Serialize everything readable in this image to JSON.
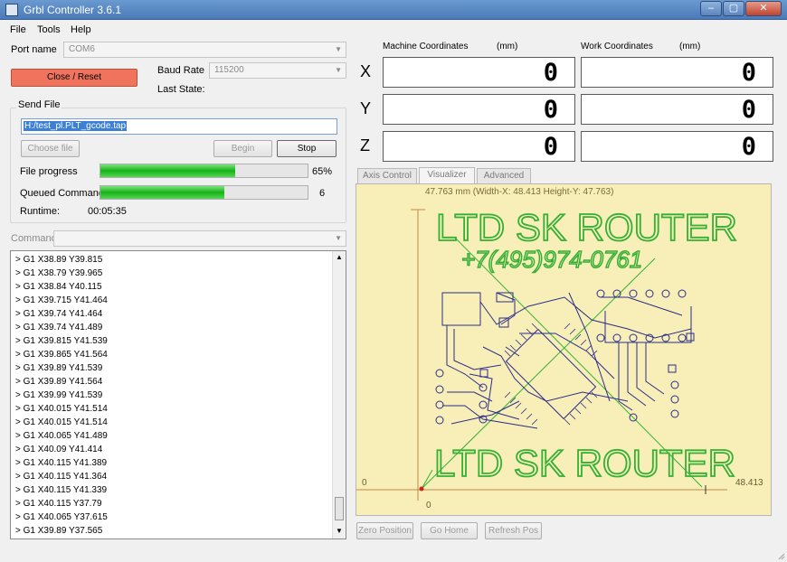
{
  "window": {
    "title": "Grbl Controller 3.6.1",
    "buttons": [
      "–",
      "▢",
      "✕"
    ]
  },
  "menu": [
    "File",
    "Tools",
    "Help"
  ],
  "port": {
    "label": "Port name",
    "value": "COM6"
  },
  "close_reset_label": "Close / Reset",
  "baud": {
    "label": "Baud Rate",
    "value": "115200"
  },
  "last_state_label": "Last State:",
  "send_file": {
    "group_label": "Send File",
    "path": "H:/test_pl.PLT_gcode.tap",
    "choose_label": "Choose file",
    "begin_label": "Begin",
    "stop_label": "Stop",
    "file_progress_label": "File progress",
    "file_progress_value": "65%",
    "file_progress_fraction": 0.65,
    "queued_label": "Queued Commands",
    "queued_value": "6",
    "queued_fraction": 0.6,
    "runtime_label": "Runtime:",
    "runtime_value": "00:05:35"
  },
  "command_label": "Command",
  "console_lines": [
    "> G1 X38.89 Y39.815",
    "> G1 X38.79 Y39.965",
    "> G1 X38.84 Y40.115",
    "> G1 X39.715 Y41.464",
    "> G1 X39.74 Y41.464",
    "> G1 X39.74 Y41.489",
    "> G1 X39.815 Y41.539",
    "> G1 X39.865 Y41.564",
    "> G1 X39.89 Y41.539",
    "> G1 X39.89 Y41.564",
    "> G1 X39.99 Y41.539",
    "> G1 X40.015 Y41.514",
    "> G1 X40.015 Y41.514",
    "> G1 X40.065 Y41.489",
    "> G1 X40.09 Y41.414",
    "> G1 X40.115 Y41.389",
    "> G1 X40.115 Y41.364",
    "> G1 X40.115 Y41.339",
    "> G1 X40.115 Y37.79",
    "> G1 X40.065 Y37.615",
    "> G1 X39.89 Y37.565"
  ],
  "coords": {
    "machine_label": "Machine Coordinates",
    "work_label": "Work Coordinates",
    "unit": "(mm)",
    "axes": [
      {
        "name": "X",
        "machine": "0",
        "work": "0"
      },
      {
        "name": "Y",
        "machine": "0",
        "work": "0"
      },
      {
        "name": "Z",
        "machine": "0",
        "work": "0"
      }
    ]
  },
  "tabs": [
    "Axis Control",
    "Visualizer",
    "Advanced"
  ],
  "visualizer": {
    "header": "47.763 mm  (Width-X: 48.413  Height-Y: 47.763)",
    "title_top": "LTD SK ROUTER",
    "phone": "+7(495)974-0761",
    "title_bottom": "LTD SK ROUTER",
    "x_max": "48.413",
    "x_zero": "0",
    "y_zero": "0"
  },
  "bottom_buttons": [
    "Zero Position",
    "Go Home",
    "Refresh Pos"
  ],
  "colors": {
    "accent_red": "#f0735e",
    "viz_bg": "#f8efb8",
    "progress_green": "#16b316",
    "trace_blue": "#2c2c8a",
    "route_green": "#35b035"
  }
}
